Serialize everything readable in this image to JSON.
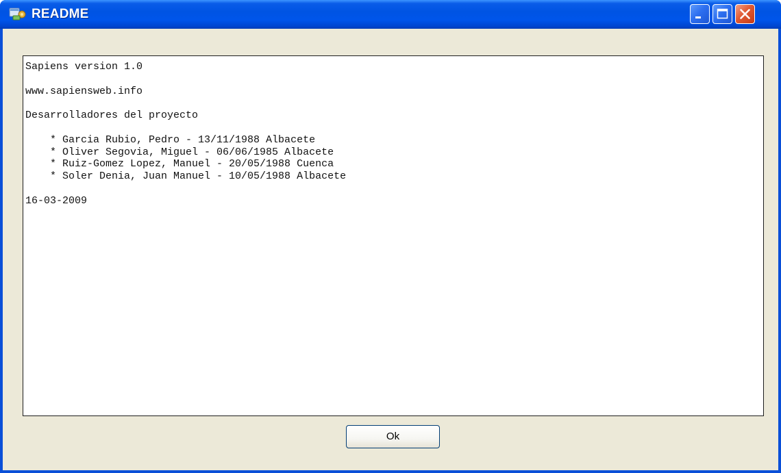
{
  "window": {
    "title": "README",
    "icon": "sapiens-app-icon",
    "controls": {
      "minimize_icon": "minimize-icon",
      "maximize_icon": "maximize-icon",
      "close_icon": "close-icon"
    },
    "colors": {
      "titlebar": "#0054E3",
      "client": "#ECE9D8",
      "close_button": "#E05A33"
    }
  },
  "readme": {
    "lines": [
      "Sapiens version 1.0",
      "",
      "www.sapiensweb.info",
      "",
      "Desarrolladores del proyecto",
      "",
      "    * Garcia Rubio, Pedro - 13/11/1988 Albacete",
      "    * Oliver Segovia, Miguel - 06/06/1985 Albacete",
      "    * Ruiz-Gomez Lopez, Manuel - 20/05/1988 Cuenca",
      "    * Soler Denia, Juan Manuel - 10/05/1988 Albacete",
      "",
      "16-03-2009"
    ]
  },
  "footer": {
    "ok_label": "Ok"
  }
}
